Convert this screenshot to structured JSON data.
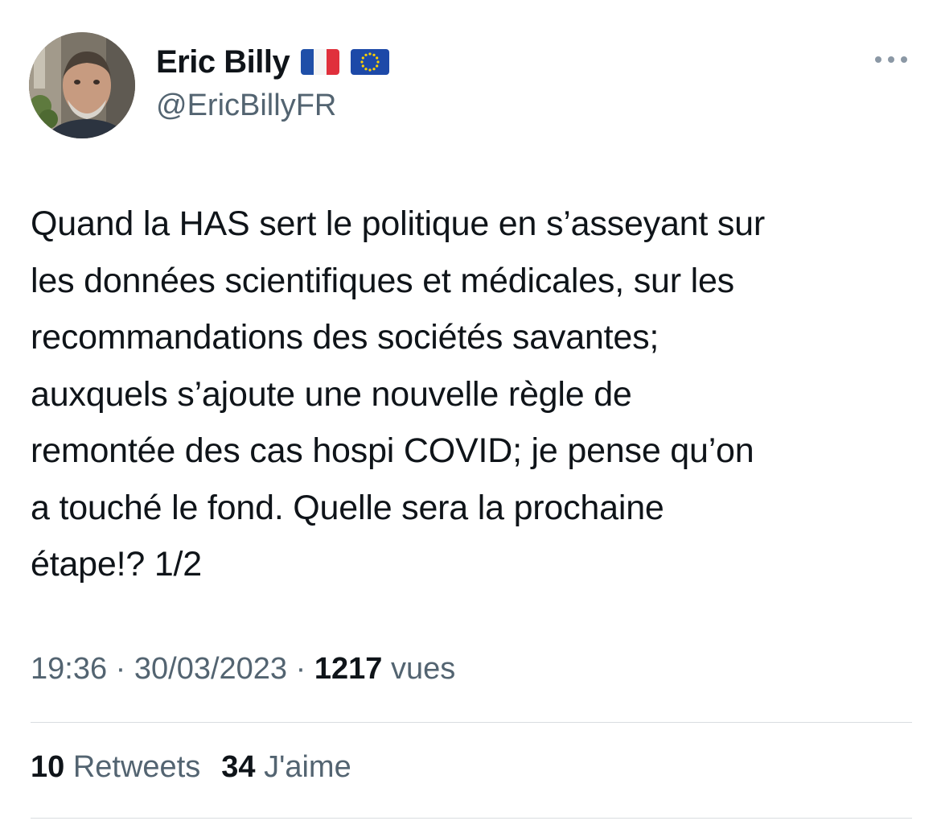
{
  "author": {
    "display_name": "Eric Billy",
    "handle": "@EricBillyFR",
    "badges": [
      "flag-france-icon",
      "flag-eu-icon"
    ]
  },
  "more_icon": "more-horizontal-icon",
  "tweet": {
    "lines": [
      "Quand la HAS sert le politique en s’asseyant sur",
      "les données scientifiques et médicales, sur les",
      "recommandations des sociétés savantes;",
      "auxquels s’ajoute une nouvelle règle de",
      "remontée des cas hospi COVID; je pense qu’on",
      "a touché le fond. Quelle sera la prochaine",
      "étape!? 1/2"
    ]
  },
  "meta": {
    "time": "19:36",
    "separator": "·",
    "date": "30/03/2023",
    "views_count": "1217",
    "views_label": "vues"
  },
  "stats": {
    "retweets_count": "10",
    "retweets_label": "Retweets",
    "likes_count": "34",
    "likes_label": "J'aime"
  },
  "colors": {
    "text": "#0f1419",
    "secondary": "#536471",
    "divider": "#d9dde0"
  }
}
